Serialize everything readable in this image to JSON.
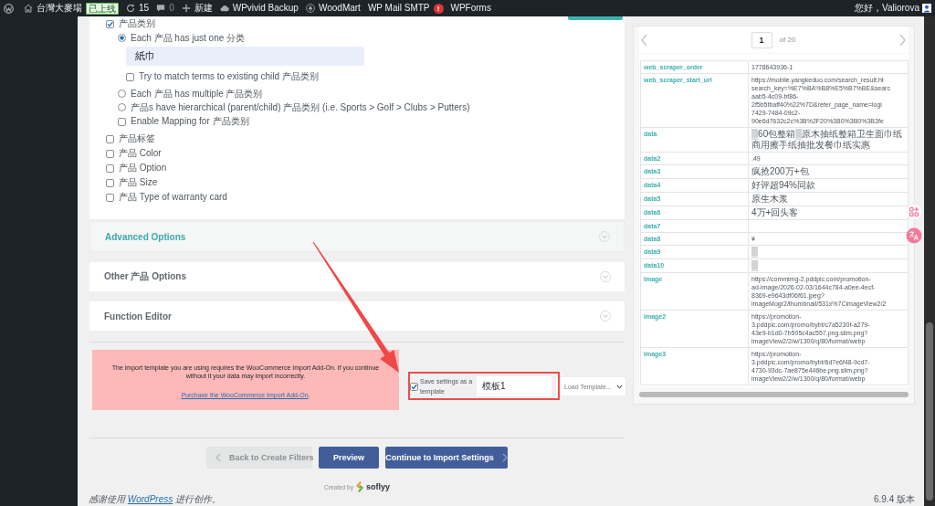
{
  "admin_bar": {
    "items": [
      {
        "kind": "logo"
      },
      {
        "kind": "site",
        "label": "台灣大麥場",
        "badge": "已上线"
      },
      {
        "kind": "updates",
        "label": "15"
      },
      {
        "kind": "comments",
        "label": "0"
      },
      {
        "kind": "new",
        "label": "新建"
      },
      {
        "kind": "backup",
        "label": "WPvivid Backup"
      },
      {
        "kind": "theme",
        "label": "WoodMart"
      },
      {
        "kind": "mail",
        "label": "WP Mail SMTP",
        "badge": "!"
      },
      {
        "kind": "forms",
        "label": "WPForms"
      }
    ],
    "greeting": "您好，Valiorova"
  },
  "taxonomies": [
    {
      "kind": "checkbox",
      "label": "产品类别",
      "checked": true,
      "children": [
        {
          "kind": "radio",
          "label": "Each 产品 has just one 分类",
          "selected": true,
          "children": [
            {
              "kind": "input",
              "value": "紙巾"
            },
            {
              "kind": "checkbox",
              "label": "Try to match terms to existing child 产品类别",
              "checked": false
            }
          ]
        },
        {
          "kind": "radio",
          "label": "Each 产品 has multiple 产品类别",
          "selected": false
        },
        {
          "kind": "radio",
          "label": "产品s have hierarchical (parent/child) 产品类别 (i.e. Sports > Golf > Clubs > Putters)",
          "selected": false
        },
        {
          "kind": "checkbox",
          "label": "Enable Mapping for 产品类别",
          "checked": false
        }
      ]
    },
    {
      "kind": "checkbox",
      "label": "产品标签",
      "checked": false
    },
    {
      "kind": "checkbox",
      "label": "产品 Color",
      "checked": false
    },
    {
      "kind": "checkbox",
      "label": "产品 Option",
      "checked": false
    },
    {
      "kind": "checkbox",
      "label": "产品 Size",
      "checked": false
    },
    {
      "kind": "checkbox",
      "label": "产品 Type of warranty card",
      "checked": false
    }
  ],
  "sections": [
    {
      "title": "Advanced Options",
      "active": true,
      "expanded": false
    },
    {
      "title": "Other 产品 Options",
      "active": false,
      "expanded": false
    },
    {
      "title": "Function Editor",
      "active": false,
      "expanded": false
    }
  ],
  "notice": {
    "text": "The import template you are using requires the WooCommerce Import Add-On. If you continue without it your data may import incorrectly.",
    "link": "Purchase the WooCommerce Import Add-On",
    "after_link": "."
  },
  "template": {
    "save_label": "Save settings as a template",
    "save_checked": true,
    "name": "模板1",
    "load_select": "Load Template..."
  },
  "buttons": [
    {
      "kind": "back",
      "label": "Back to Create Filters"
    },
    {
      "kind": "primary",
      "label": "Preview"
    },
    {
      "kind": "next",
      "label": "Continue to Import Settings"
    }
  ],
  "credit": {
    "prefix": "Created by",
    "brand": "soflyy"
  },
  "preview": {
    "page": "1",
    "of": "of 20",
    "rows": [
      {
        "key": "web_scraper_order",
        "value": "1778643936-1"
      },
      {
        "key": "web_scraper_start_url",
        "value": "https://mobile.yangkeduo.com/search_result.ht\nsearch_key=%E7%BA%B8%E5%B7%BE&searc\naab5-4c09-bf86-\n2f5b5fbaff40%22%7D&refer_page_name=logi\n7429-7484-09c2-\n90e6d7632c2c%3B%2F20%3B0%3B0%3B3fe"
      },
      {
        "key": "data",
        "value": "▒60包整箱▒原木抽纸整箱卫生面巾纸商用擦手纸抽批发餐巾纸实惠"
      },
      {
        "key": "data2",
        "value": ".49"
      },
      {
        "key": "data3",
        "value": "疯抢200万+包"
      },
      {
        "key": "data4",
        "value": "好评超94%同款"
      },
      {
        "key": "data5",
        "value": "原生木浆"
      },
      {
        "key": "data6",
        "value": "4万+回头客"
      },
      {
        "key": "data7"
      },
      {
        "key": "data8",
        "value": "¥"
      },
      {
        "key": "data9",
        "value": "▒"
      },
      {
        "key": "data10",
        "value": "▒"
      },
      {
        "key": "image",
        "value": "https://commimg-2.pddpic.com/promotion-\nad-image/2026-02-03/1644c784-a0ee-4ecf-\n8369-e9643df06f61.jpeg?\nimageMogr2/thumbnail/531x%7CimageView2/2"
      },
      {
        "key": "image2",
        "value": "https://promotion-\n3.pddpic.com/promo/bybt/c7a5230f-a279-\n43e9-b1d0-7b505c4ac557.png.slim.png?\nimageView2/2/w/1300/q/80/format/webp"
      },
      {
        "key": "image3",
        "value": "https://promotion-\n3.pddpic.com/promo/bybt/6d7e6f48-9cd7-\n4730-93dc-7ae875e446be.png.slim.png?\nimageView2/2/w/1300/q/80/format/webp"
      }
    ]
  },
  "floating_buttons": [
    {
      "kind": "grid"
    },
    {
      "kind": "translate"
    }
  ],
  "annotations": {
    "arrow": true,
    "frame": true
  },
  "footer": {
    "before": "感谢使用 ",
    "link": "WordPress",
    "after": " 进行创作。",
    "version": "6.9.4 版本"
  }
}
